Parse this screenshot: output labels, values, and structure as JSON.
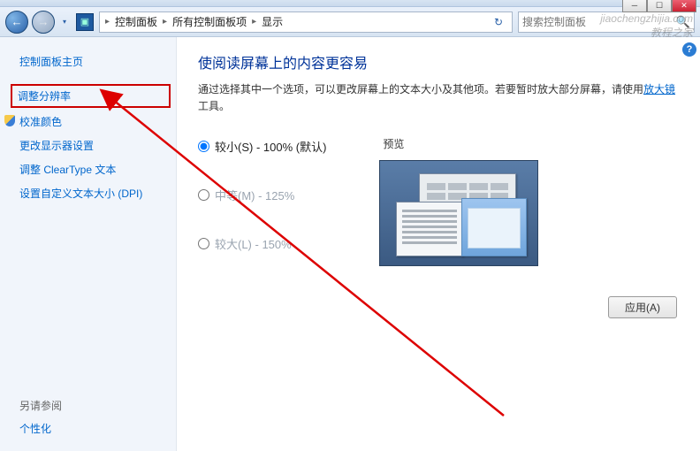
{
  "titlebar": {
    "min": "─",
    "max": "☐",
    "close": "✕"
  },
  "toolbar": {
    "back_arrow": "←",
    "fwd_arrow": "→",
    "dd": "▾",
    "folder_icon": "▣",
    "refresh": "↻"
  },
  "breadcrumb": {
    "sep": "▸",
    "items": [
      "控制面板",
      "所有控制面板项",
      "显示"
    ]
  },
  "search": {
    "placeholder": "搜索控制面板",
    "icon": "🔍"
  },
  "sidebar": {
    "home": "控制面板主页",
    "items": [
      {
        "label": "调整分辨率",
        "highlighted": true
      },
      {
        "label": "校准颜色",
        "shield": true
      },
      {
        "label": "更改显示器设置"
      },
      {
        "label": "调整 ClearType 文本"
      },
      {
        "label": "设置自定义文本大小 (DPI)"
      }
    ],
    "seealso_heading": "另请参阅",
    "seealso_items": [
      "个性化"
    ]
  },
  "content": {
    "help": "?",
    "title": "使阅读屏幕上的内容更容易",
    "desc_pre": "通过选择其中一个选项，可以更改屏幕上的文本大小及其他项。若要暂时放大部分屏幕，请使用",
    "desc_link": "放大镜",
    "desc_post": "工具。",
    "preview_label": "预览",
    "options": [
      {
        "label": "较小(S) - 100% (默认)",
        "checked": true,
        "dim": false
      },
      {
        "label": "中等(M) - 125%",
        "checked": false,
        "dim": true
      },
      {
        "label": "较大(L) - 150%",
        "checked": false,
        "dim": true
      }
    ],
    "apply_label": "应用(A)"
  },
  "watermark": {
    "line1": "jiaochengzhijia.com",
    "line2": "教程之家"
  }
}
